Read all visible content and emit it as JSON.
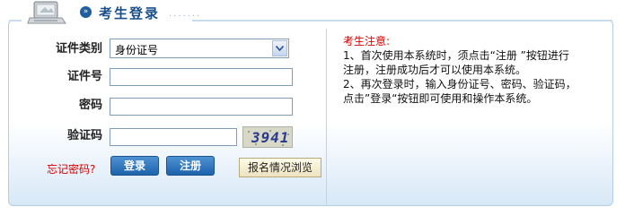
{
  "header": {
    "title": "考生登录",
    "icon": "monitor-icon",
    "bullet": "»"
  },
  "form": {
    "id_type_label": "证件类别",
    "id_type_value": "身份证号",
    "id_number_label": "证件号",
    "id_number_value": "",
    "password_label": "密码",
    "password_value": "",
    "captcha_label": "验证码",
    "captcha_value": "",
    "captcha_image_text": "3941",
    "forgot_label": "忘记密码?",
    "login_label": "登录",
    "register_label": "注册",
    "browse_label": "报名情况浏览"
  },
  "notice": {
    "title": "考生注意:",
    "lines": [
      "1、首次使用本系统时，须点击“注册 ”按钮进行",
      "注册，注册成功后才可以使用本系统。",
      "2、再次登录时，输入身份证号、密码、验证码，",
      "点击”登录“按钮即可使用和操作本系统。"
    ]
  },
  "colors": {
    "accent": "#1a4f8a",
    "button_blue": "#1c63ad",
    "warning_red": "#d40000",
    "panel_border": "#b5cde4"
  }
}
